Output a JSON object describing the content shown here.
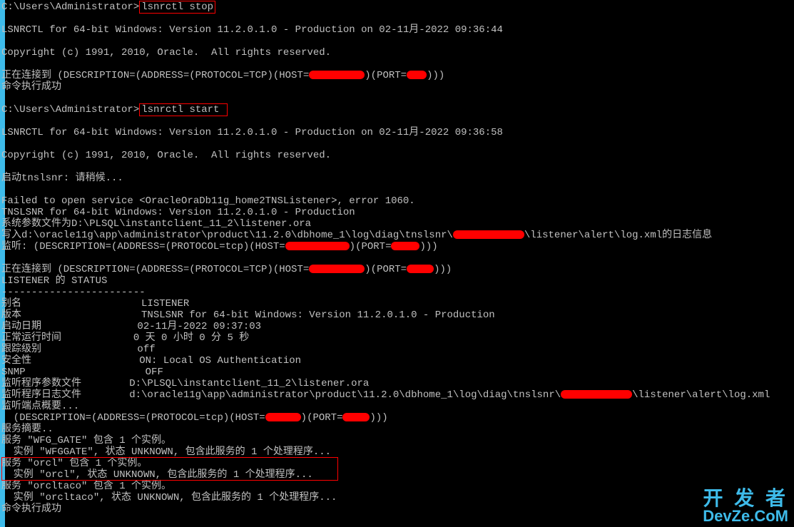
{
  "prompt1": "C:\\Users\\Administrator>",
  "cmd_stop": "lsnrctl stop",
  "banner1": "LSNRCTL for 64-bit Windows: Version 11.2.0.1.0 - Production on 02-11月-2022 09:36:44",
  "copyright": "Copyright (c) 1991, 2010, Oracle.  All rights reserved.",
  "connecting_prefix": "正在连接到 (DESCRIPTION=(ADDRESS=(PROTOCOL=TCP)(HOST=",
  "port_mid": ")(PORT=",
  "paren_end": ")))",
  "cmd_success": "命令执行成功",
  "prompt2": "C:\\Users\\Administrator>",
  "cmd_start": "lsnrctl start",
  "banner2": "LSNRCTL for 64-bit Windows: Version 11.2.0.1.0 - Production on 02-11月-2022 09:36:58",
  "starting": "启动tnslsnr: 请稍候...",
  "failed": "Failed to open service <OracleOraDb11g_home2TNSListener>, error 1060.",
  "tnslsnr_banner": "TNSLSNR for 64-bit Windows: Version 11.2.0.1.0 - Production",
  "sysparam": "系统参数文件为D:\\PLSQL\\instantclient_11_2\\listener.ora",
  "log_prefix": "写入d:\\oracle11g\\app\\administrator\\product\\11.2.0\\dbhome_1\\log\\diag\\tnslsnr\\",
  "log_suffix": "\\listener\\alert\\log.xml的日志信息",
  "listen_prefix": "监听: (DESCRIPTION=(ADDRESS=(PROTOCOL=tcp)(HOST=",
  "connecting2_prefix": "正在连接到 (DESCRIPTION=(ADDRESS=(PROTOCOL=TCP)(HOST=",
  "listener_status": "LISTENER 的 STATUS",
  "divider": "------------------------",
  "alias_label": "别名",
  "alias_value": "LISTENER",
  "version_label": "版本",
  "version_value": "TNSLSNR for 64-bit Windows: Version 11.2.0.1.0 - Production",
  "start_date_label": "启动日期",
  "start_date_value": "02-11月-2022 09:37:03",
  "uptime_label": "正常运行时间",
  "uptime_value": "0 天 0 小时 0 分 5 秒",
  "trace_label": "跟踪级别",
  "trace_value": "off",
  "security_label": "安全性",
  "security_value": "ON: Local OS Authentication",
  "snmp_label": "SNMP",
  "snmp_value": "OFF",
  "param_file_label": "监听程序参数文件",
  "param_file_value": "D:\\PLSQL\\instantclient_11_2\\listener.ora",
  "log_file_label": "监听程序日志文件",
  "log_file_prefix": "d:\\oracle11g\\app\\administrator\\product\\11.2.0\\dbhome_1\\log\\diag\\tnslsnr\\",
  "log_file_suffix": "\\listener\\alert\\log.xml",
  "endpoint_summary": "监听端点概要...",
  "endpoint_desc_prefix": "  (DESCRIPTION=(ADDRESS=(PROTOCOL=tcp)(HOST=",
  "svc_summary": "服务摘要..",
  "svc_wfg": "服务 \"WFG_GATE\" 包含 1 个实例。",
  "inst_wfg": "  实例 \"WFGGATE\", 状态 UNKNOWN, 包含此服务的 1 个处理程序...",
  "svc_orcl": "服务 \"orcl\" 包含 1 个实例。",
  "inst_orcl": "  实例 \"orcl\", 状态 UNKNOWN, 包含此服务的 1 个处理程序...",
  "svc_orcltaco": "服务 \"orcltaco\" 包含 1 个实例。",
  "inst_orcltaco": "  实例 \"orcltaco\", 状态 UNKNOWN, 包含此服务的 1 个处理程序...",
  "watermark": {
    "line1": "开 发 者",
    "line2": "DevZe.CoM"
  }
}
